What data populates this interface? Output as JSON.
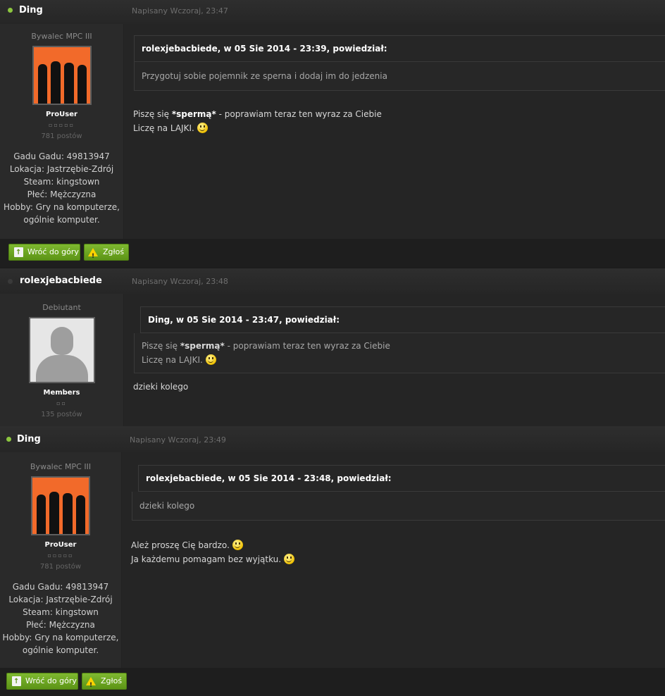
{
  "posts": [
    {
      "author": "Ding",
      "online": true,
      "date": "Napisany Wczoraj, 23:47",
      "rank": "Bywalec MPC III",
      "group": "ProUser",
      "pips": "▫▫▫▫▫",
      "postcount": "781 postów",
      "fields": [
        "Gadu Gadu: 49813947",
        "Lokacja: Jastrzębie-Zdrój",
        "Steam: kingstown",
        "Płeć: Mężczyzna",
        "Hobby: Gry na komputerze,",
        "ogólnie komputer."
      ],
      "quote": {
        "cite": "rolexjebacbiede, w 05 Sie 2014 - 23:39, powiedział:",
        "body": "Przygotuj sobie pojemnik ze sperna i dodaj im do jedzenia"
      },
      "text_line1_prefix": "Piszę się ",
      "text_line1_bold": "*spermą*",
      "text_line1_suffix": " - poprawiam teraz ten wyraz za Ciebie",
      "text_line2": "Liczę na LAJKI.",
      "buttons": {
        "top": "Wróć do góry",
        "report": "Zgłoś"
      }
    },
    {
      "author": "rolexjebacbiede",
      "online": false,
      "date": "Napisany Wczoraj, 23:48",
      "rank": "Debiutant",
      "group": "Members",
      "pips": "▫▫",
      "postcount": "135 postów",
      "quote": {
        "cite": "Ding, w 05 Sie 2014 - 23:47, powiedział:",
        "body_line1_prefix": "Piszę się ",
        "body_line1_bold": "*spermą*",
        "body_line1_suffix": " - poprawiam teraz ten wyraz za Ciebie",
        "body_line2": "Liczę na LAJKI."
      },
      "text": "dzieki kolego"
    },
    {
      "author": "Ding",
      "online": true,
      "date": "Napisany Wczoraj, 23:49",
      "rank": "Bywalec MPC III",
      "group": "ProUser",
      "pips": "▫▫▫▫▫",
      "postcount": "781 postów",
      "fields": [
        "Gadu Gadu: 49813947",
        "Lokacja: Jastrzębie-Zdrój",
        "Steam: kingstown",
        "Płeć: Mężczyzna",
        "Hobby: Gry na komputerze,",
        "ogólnie komputer."
      ],
      "quote": {
        "cite": "rolexjebacbiede, w 05 Sie 2014 - 23:48, powiedział:",
        "body": "dzieki kolego"
      },
      "text_line1": "Ależ proszę Cię bardzo.",
      "text_line2": "Ja każdemu pomagam bez wyjątku.",
      "buttons": {
        "top": "Wróć do góry",
        "report": "Zgłoś"
      }
    }
  ],
  "colors": {
    "accent": "#7fb930",
    "online": "#8cc63f",
    "avatar_bg": "#f26a2a"
  },
  "icons": {
    "smiley": "smiley-icon",
    "back_to_top": "page-up-icon",
    "report": "warning-icon"
  }
}
